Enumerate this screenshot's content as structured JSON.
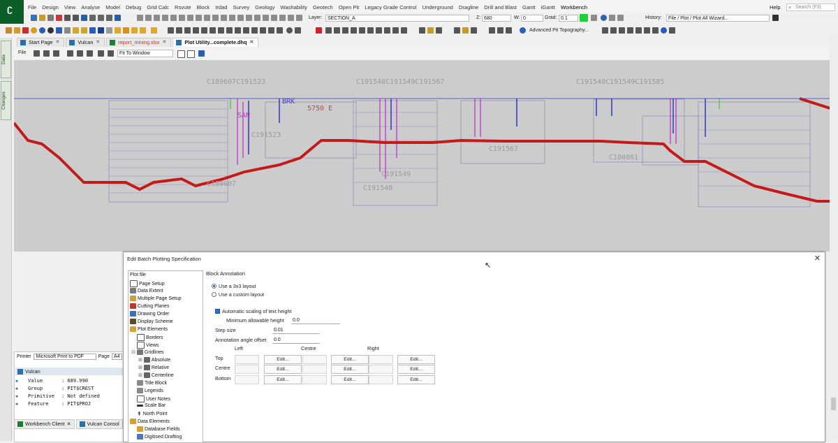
{
  "menu": {
    "items": [
      "File",
      "Design",
      "View",
      "Analyse",
      "Model",
      "Debug",
      "Grid Calc",
      "Rsvute",
      "Block",
      "Irdad",
      "Survey",
      "Geology",
      "Washability",
      "Geotech",
      "Open Pit",
      "Legacy Grade Control",
      "Underground",
      "Dragline",
      "Drill and Blast",
      "Gantt",
      "iGantt",
      "Workbench"
    ],
    "help": "Help",
    "search_placeholder": "Search (F3)"
  },
  "toolbar": {
    "layer_label": "Layer:",
    "layer_value": "SECTION_A",
    "z_label": "Z:",
    "z_value": "680",
    "w_label": "W:",
    "w_value": "0",
    "grad_label": "Grad:",
    "grad_value": "0.1",
    "history_label": "History:",
    "history_value": "File / Plot / Plot All Wizard...",
    "pit_topo_label": "Advanced Pit Topography..."
  },
  "tabs": [
    {
      "label": "Start Page",
      "color": "#2a6fb0"
    },
    {
      "label": "Vulcan",
      "color": "#2a6fb0"
    },
    {
      "label": "report_mining.xlsx",
      "color": "#1f7a3c"
    },
    {
      "label": "Plot Utility...complete.dhq",
      "color": "#2a6fb0"
    }
  ],
  "plot_toolbar": {
    "file_label": "File",
    "fit_label": "Fit To Window"
  },
  "plot": {
    "labels": [
      "C189607C191523",
      "C191548C191549C191567",
      "C191548C191549C191585",
      "C191567",
      "C191548",
      "C189607",
      "C191549",
      "C191523",
      "C180861",
      "5750 E",
      "BRK",
      "SAN"
    ]
  },
  "sidebar": {
    "data_tab": "Data",
    "changes_tab": "Changes"
  },
  "printer": {
    "label": "Printer",
    "value": "Microsoft Print to PDF",
    "page_label": "Page",
    "page_value": "A4"
  },
  "vulcan_panel": {
    "title": "Vulcan",
    "rows": [
      {
        "key": "Value",
        "value": ": 689.990"
      },
      {
        "key": "Group",
        "value": ": PIT$CREST"
      },
      {
        "key": "Primitive",
        "value": ": Not defined"
      },
      {
        "key": "Feature",
        "value": ": PIT$PROJ"
      }
    ]
  },
  "bottom_tabs": [
    "Workbench Client",
    "Vulcan Consol"
  ],
  "dialog": {
    "title": "Edit Batch Plotting Specification",
    "tree": [
      "Plot file",
      "Page Setup",
      "Data Extent",
      "Multiple Page Setup",
      "Cutting Planes",
      "Drawing Order",
      "Display Scheme",
      "Plot Elements",
      "Borders",
      "Views",
      "Gridlines",
      "Absolute",
      "Relative",
      "Centerline",
      "Title Block",
      "Legends",
      "User Notes",
      "Scale Bar",
      "North Point",
      "Data Elements",
      "Database Fields",
      "Digitised Drafting"
    ],
    "section_title": "Block Annotation",
    "radio_3x3": "Use a 3x3 layout",
    "radio_custom": "Use a custom layout",
    "auto_scale": "Automatic scaling of text height",
    "min_height_label": "Minimum allowable height",
    "min_height_value": "0.0",
    "step_label": "Step size",
    "step_value": "0.01",
    "angle_label": "Annotation angle offset",
    "angle_value": "0.0",
    "col_left": "Left",
    "col_centre": "Centre",
    "col_right": "Right",
    "row_top": "Top",
    "row_centre": "Centre",
    "row_bottom": "Bottom",
    "edit": "Edit..."
  },
  "colors": {
    "accent_green": "#0b5e2a",
    "plot_red": "#c41a1a",
    "plot_magenta": "#c02bc8",
    "plot_blue": "#3b3bd1"
  }
}
